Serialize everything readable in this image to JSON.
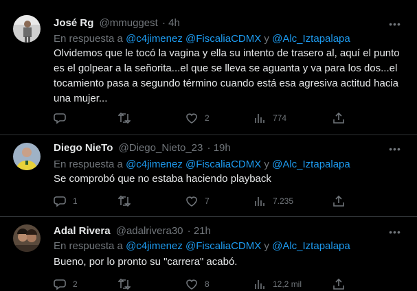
{
  "tweets": [
    {
      "name": "José Rg",
      "handle": "@mmuggest",
      "time": "· 4h",
      "reply_prefix": "En respuesta a ",
      "mention1": "@c4jimenez",
      "mention2": "@FiscaliaCDMX",
      "reply_and": " y ",
      "mention3": "@Alc_Iztapalapa",
      "text": "Olvidemos que le tocó la vagina y ella su intento de trasero al, aquí el punto es el golpear a la señorita...el que se lleva se aguanta y va para los dos...el tocamiento pasa a segundo término cuando está esa agresiva actitud hacia una mujer...",
      "replies": "",
      "retweets": "",
      "likes": "2",
      "views": "774"
    },
    {
      "name": "Diego NieTo",
      "handle": "@Diego_Nieto_23",
      "time": "· 19h",
      "reply_prefix": "En respuesta a ",
      "mention1": "@c4jimenez",
      "mention2": "@FiscaliaCDMX",
      "reply_and": " y ",
      "mention3": "@Alc_Iztapalapa",
      "text": "Se comprobó que no estaba haciendo playback",
      "replies": "1",
      "retweets": "",
      "likes": "7",
      "views": "7.235"
    },
    {
      "name": "Adal Rivera",
      "handle": "@adalrivera30",
      "time": "· 21h",
      "reply_prefix": "En respuesta a ",
      "mention1": "@c4jimenez",
      "mention2": "@FiscaliaCDMX",
      "reply_and": " y ",
      "mention3": "@Alc_Iztapalapa",
      "text": "Bueno, por lo pronto su \"carrera\" acabó.",
      "replies": "2",
      "retweets": "",
      "likes": "8",
      "views": "12,2 mil"
    }
  ],
  "colors": {
    "background": "#000000",
    "text": "#e7e9ea",
    "muted": "#71767b",
    "link": "#1d9bf0",
    "divider": "#2f3336"
  },
  "icons": {
    "reply": "reply-icon",
    "retweet": "retweet-icon",
    "like": "heart-icon",
    "views": "views-icon",
    "share": "share-icon",
    "more": "more-icon"
  }
}
